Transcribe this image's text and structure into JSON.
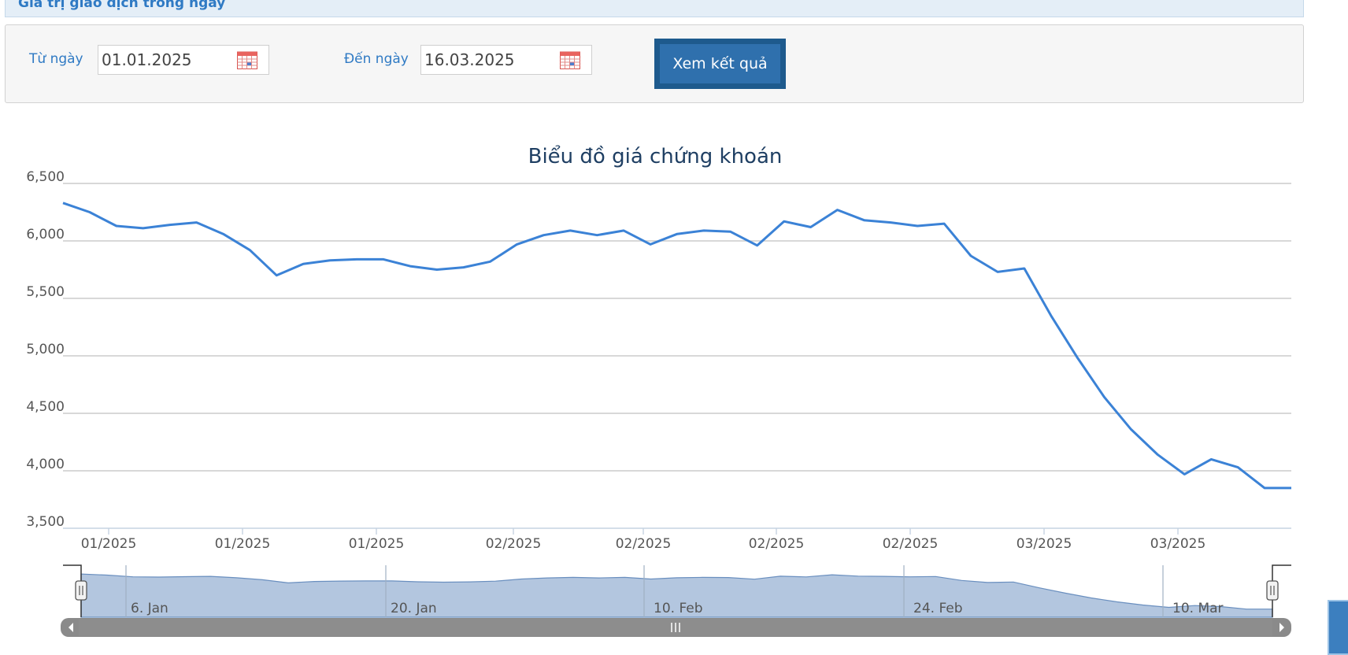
{
  "header": {
    "partial_title": "Giá trị giao dịch trong ngày"
  },
  "filter": {
    "from_label": "Từ ngày",
    "from_value": "01.01.2025",
    "to_label": "Đến ngày",
    "to_value": "16.03.2025",
    "submit_label": "Xem kết quả",
    "calendar_icon": "calendar-icon"
  },
  "chart_data": {
    "type": "line",
    "title": "Biểu đồ giá chứng khoán",
    "ylim": [
      3500,
      6500
    ],
    "y_ticks": [
      "6,500",
      "6,000",
      "5,500",
      "5,000",
      "4,500",
      "4,000",
      "3,500"
    ],
    "x_tick_labels": [
      "01/2025",
      "01/2025",
      "01/2025",
      "02/2025",
      "02/2025",
      "02/2025",
      "02/2025",
      "03/2025",
      "03/2025"
    ],
    "grid": true,
    "color": "#3b82d6",
    "series": [
      {
        "values": [
          6330,
          6250,
          6130,
          6110,
          6140,
          6160,
          6060,
          5920,
          5700,
          5800,
          5830,
          5840,
          5840,
          5780,
          5750,
          5770,
          5820,
          5970,
          6050,
          6090,
          6050,
          6090,
          5970,
          6060,
          6090,
          6080,
          5960,
          6170,
          6120,
          6270,
          6180,
          6160,
          6130,
          6150,
          5870,
          5730,
          5760,
          5350,
          4980,
          4640,
          4360,
          4140,
          3970,
          4100,
          4030,
          3850,
          3850
        ]
      }
    ],
    "navigator": {
      "labels": [
        "6. Jan",
        "20. Jan",
        "10. Feb",
        "24. Feb",
        "10. Mar"
      ],
      "scrollbar_icon": "grip-icon"
    }
  }
}
